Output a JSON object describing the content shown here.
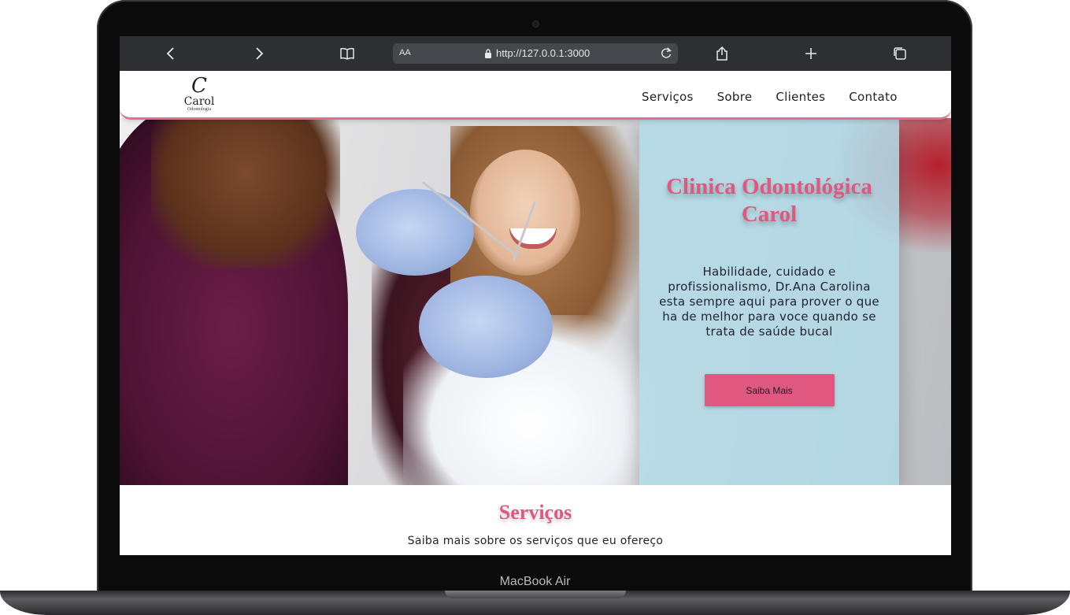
{
  "device": {
    "label": "MacBook Air"
  },
  "browser": {
    "text_size_label": "AA",
    "url": "http://127.0.0.1:3000"
  },
  "site": {
    "logo": {
      "mark": "C",
      "name": "Carol",
      "sub": "Odontologia"
    },
    "nav": [
      "Serviços",
      "Sobre",
      "Clientes",
      "Contato"
    ],
    "hero": {
      "title": "Clinica Odontológica Carol",
      "text": "Habilidade, cuidado e profissionalismo, Dr.Ana Carolina esta sempre aqui para prover o que ha de melhor para voce quando se trata de saúde bucal",
      "button": "Saiba Mais"
    },
    "services": {
      "title": "Serviços",
      "subtitle": "Saiba mais sobre os serviços que eu ofereço"
    }
  },
  "colors": {
    "accent": "#e0577f",
    "panel": "#b2dae8",
    "toolbar": "#2d2f33"
  },
  "icons": [
    "back-icon",
    "forward-icon",
    "bookmarks-icon",
    "lock-icon",
    "reload-icon",
    "share-icon",
    "new-tab-icon",
    "tabs-icon"
  ]
}
